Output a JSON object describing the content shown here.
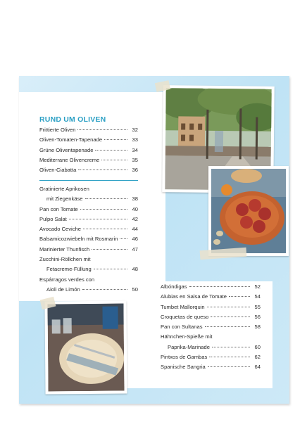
{
  "section": {
    "title": "RUND UM OLIVEN"
  },
  "toc_a": [
    {
      "title": "Frittierte Oliven",
      "page": "32"
    },
    {
      "title": "Oliven-Tomaten-Tapenade",
      "page": "33"
    },
    {
      "title": "Grüne Oliventapenade",
      "page": "34"
    },
    {
      "title": "Mediterrane Olivencreme",
      "page": "35"
    },
    {
      "title": "Oliven-Ciabatta",
      "page": "36"
    }
  ],
  "toc_b": [
    {
      "title": "Gratinierte Aprikosen",
      "page": ""
    },
    {
      "title": "mit Ziegenkäse",
      "page": "38"
    },
    {
      "title": "Pan con Tomate",
      "page": "40"
    },
    {
      "title": "Pulpo Salat",
      "page": "42"
    },
    {
      "title": "Avocado Ceviche",
      "page": "44"
    },
    {
      "title": "Balsamicozwiebeln mit Rosmarin",
      "page": "46"
    },
    {
      "title": "Marinierter Thunfisch",
      "page": "47"
    },
    {
      "title": "Zucchini-Röllchen mit",
      "page": ""
    },
    {
      "title": "Fetacreme-Füllung",
      "page": "48"
    },
    {
      "title": "Espárragos verdes con",
      "page": ""
    },
    {
      "title": "Aioli de Limón",
      "page": "50"
    }
  ],
  "toc_c": [
    {
      "title": "Albóndigas",
      "page": "52"
    },
    {
      "title": "Alubias en Salsa de Tomate",
      "page": "54"
    },
    {
      "title": "Tumbet Mallorquin",
      "page": "55"
    },
    {
      "title": "Croquetas de queso",
      "page": "56"
    },
    {
      "title": "Pan con Sultanas",
      "page": "58"
    },
    {
      "title": "Hähnchen-Spieße mit",
      "page": ""
    },
    {
      "title": "Paprika-Marinade",
      "page": "60"
    },
    {
      "title": "Pintxos de Gambas",
      "page": "62"
    },
    {
      "title": "Spanische Sangria",
      "page": "64"
    }
  ]
}
